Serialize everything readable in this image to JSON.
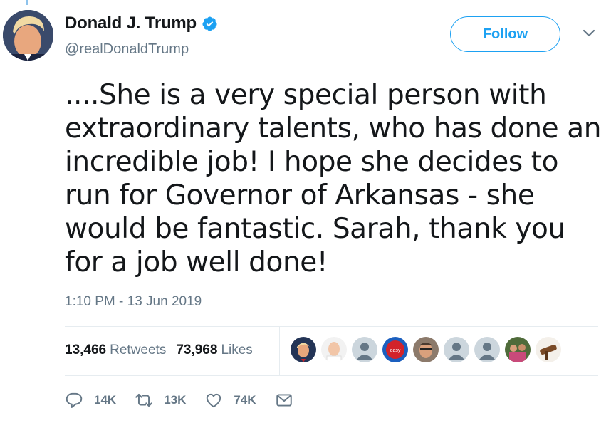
{
  "author": {
    "display_name": "Donald J. Trump",
    "handle": "@realDonaldTrump",
    "verified": true
  },
  "follow_label": "Follow",
  "tweet": {
    "text": "....She is a very special person with extraordinary talents, who has done an incredible job! I hope she decides to run for Governor of Arkansas - she would be fantastic. Sarah, thank you for a job well done!",
    "timestamp": "1:10 PM - 13 Jun 2019"
  },
  "stats": {
    "retweets_count": "13,466",
    "retweets_label": "Retweets",
    "likes_count": "73,968",
    "likes_label": "Likes"
  },
  "actions": {
    "reply_count": "14K",
    "retweet_count": "13K",
    "like_count": "74K"
  },
  "colors": {
    "accent": "#1da1f2",
    "muted_text": "#657786",
    "divider": "#e6ecf0"
  },
  "icons": [
    "verified-badge-icon",
    "chevron-down-icon",
    "reply-icon",
    "retweet-icon",
    "heart-icon",
    "envelope-icon"
  ]
}
